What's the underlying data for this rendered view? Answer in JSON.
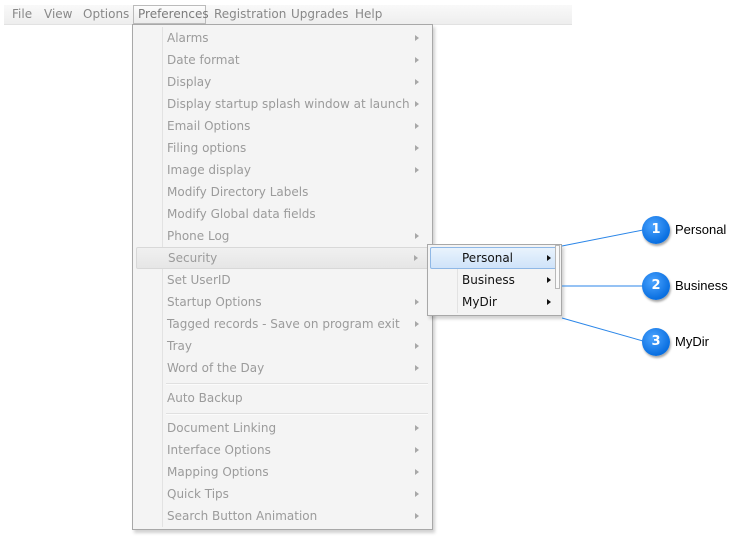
{
  "menubar": {
    "items": [
      "File",
      "View",
      "Options",
      "Preferences",
      "Registration",
      "Upgrades",
      "Help"
    ],
    "active": "Preferences"
  },
  "preferences_menu": {
    "items": [
      {
        "label": "Alarms",
        "submenu": true
      },
      {
        "label": "Date format",
        "submenu": true
      },
      {
        "label": "Display",
        "submenu": true
      },
      {
        "label": "Display startup splash window at launch",
        "submenu": true
      },
      {
        "label": "Email Options",
        "submenu": true
      },
      {
        "label": "Filing options",
        "submenu": true
      },
      {
        "label": "Image display",
        "submenu": true
      },
      {
        "label": "Modify Directory Labels",
        "submenu": false
      },
      {
        "label": "Modify Global data fields",
        "submenu": false
      },
      {
        "label": "Phone Log",
        "submenu": true
      },
      {
        "label": "Security",
        "submenu": true
      },
      {
        "label": "Set UserID",
        "submenu": false
      },
      {
        "label": "Startup Options",
        "submenu": true
      },
      {
        "label": "Tagged records - Save on program exit",
        "submenu": true
      },
      {
        "label": "Tray",
        "submenu": true
      },
      {
        "label": "Word of the Day",
        "submenu": true
      },
      {
        "label": "Auto Backup",
        "submenu": false
      },
      {
        "label": "Document Linking",
        "submenu": true
      },
      {
        "label": "Interface Options",
        "submenu": true
      },
      {
        "label": "Mapping Options",
        "submenu": true
      },
      {
        "label": "Quick Tips",
        "submenu": true
      },
      {
        "label": "Search Button Animation",
        "submenu": true
      }
    ],
    "highlighted": "Security"
  },
  "security_submenu": {
    "items": [
      {
        "label": "Personal",
        "submenu": true
      },
      {
        "label": "Business",
        "submenu": true
      },
      {
        "label": "MyDir",
        "submenu": true
      }
    ],
    "highlighted": "Personal"
  },
  "callouts": [
    {
      "number": "1",
      "label": "Personal"
    },
    {
      "number": "2",
      "label": "Business"
    },
    {
      "number": "3",
      "label": "MyDir"
    }
  ],
  "colors": {
    "badge": "#0a6fe0",
    "callout_line": "#2b86e8",
    "submenu_highlight": "#cfe3f9"
  }
}
